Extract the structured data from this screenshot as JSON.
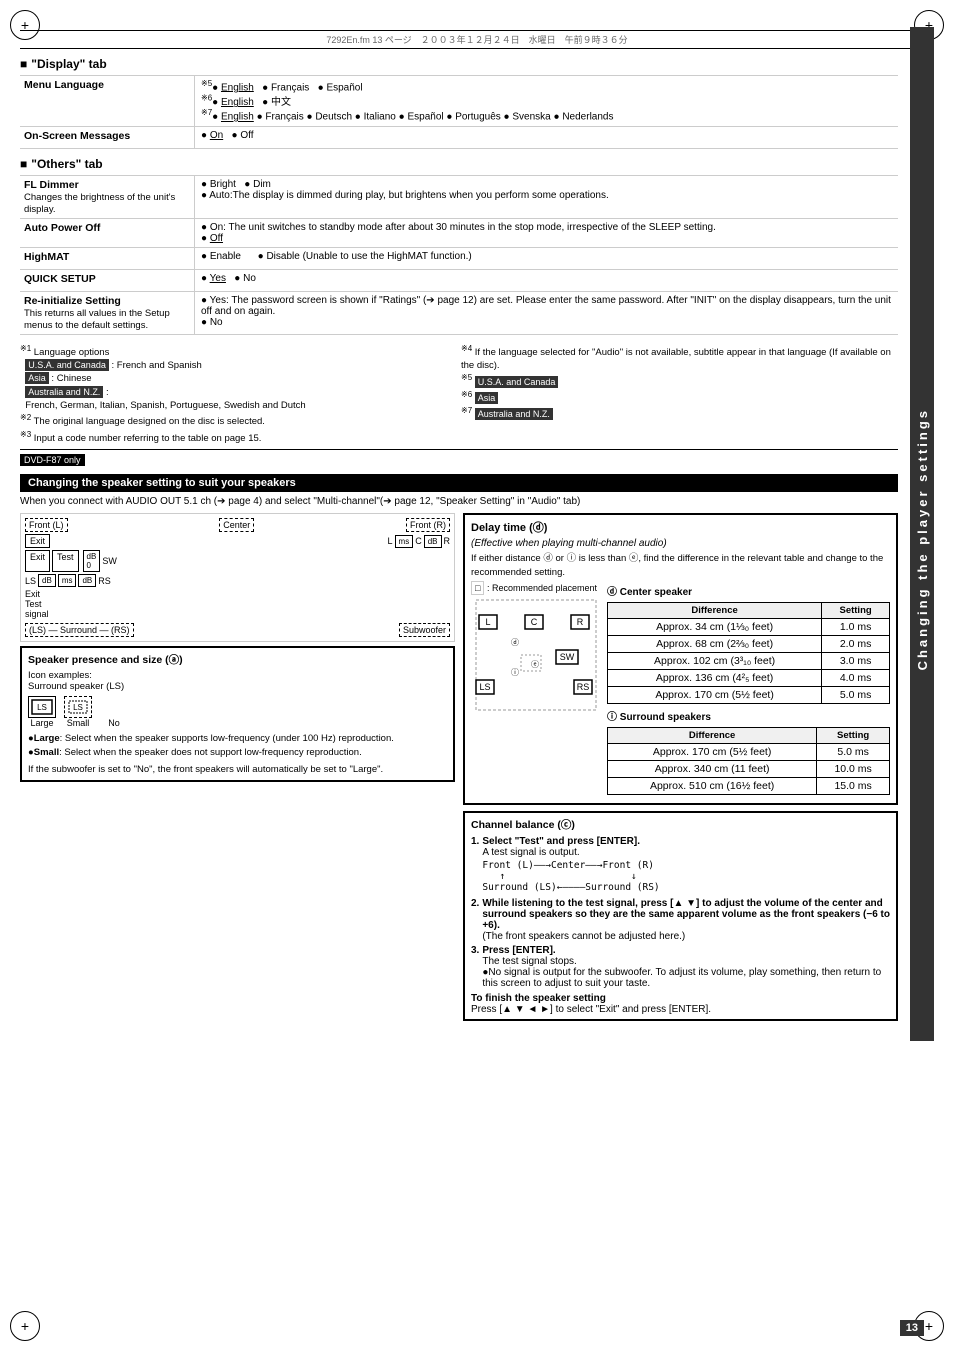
{
  "page": {
    "header_line": "7292En.fm  13 ページ　２００３年１２月２４日　水曜日　午前９時３６分",
    "page_number": "13",
    "sidebar_text": "Changing the player settings"
  },
  "display_tab": {
    "title": "\"Display\" tab",
    "rows": [
      {
        "label": "Menu Language",
        "value": "※5● English  ● Français  ● Español\n※6● English  ● 中文\n※7● English  ● Français  ● Deutsch  ● Italiano  ● Español  ● Português  ● Svenska  ● Nederlands"
      },
      {
        "label": "On-Screen Messages",
        "value": "● On  ● Off"
      }
    ]
  },
  "others_tab": {
    "title": "\"Others\" tab",
    "rows": [
      {
        "label": "FL Dimmer",
        "sublabel": "Changes the brightness of the unit's display.",
        "value": "● Bright  ● Dim\n● Auto:The display is dimmed during play, but brightens when you perform some operations."
      },
      {
        "label": "Auto Power Off",
        "value": "● On:  The unit switches to standby mode after about 30 minutes in the stop mode, irrespective of the SLEEP setting.\n● Off"
      },
      {
        "label": "HighMAT",
        "value": "● Enable        ● Disable (Unable to use the HighMAT function.)"
      },
      {
        "label": "QUICK SETUP",
        "value": "● Yes  ● No"
      },
      {
        "label": "Re-initialize Setting",
        "sublabel": "This returns all values in the Setup menus to the default settings.",
        "value": "● Yes: The password screen is shown if \"Ratings\" (➔ page 12) are set. Please enter the same password. After \"INIT\" on the display disappears, turn the unit off and on again.\n● No"
      }
    ]
  },
  "notes": {
    "left": [
      "※1  Language options",
      "U.S.A. and Canada : French and Spanish",
      "Asia : Chinese",
      "Australia and N.Z. :",
      "French, German, Italian, Spanish, Portuguese, Swedish and Dutch",
      "※2  The original language designed on the disc is selected.",
      "※3  Input a code number referring to the table on page 15."
    ],
    "right": [
      "※4  If the language selected for \"Audio\" is not available, subtitle appear in that language (If available on the disc).",
      "※5  U.S.A. and Canada",
      "※6  Asia",
      "※7  Australia and N.Z."
    ]
  },
  "dvd_only": "DVD-F87 only",
  "speaker_section": {
    "title": "Changing the speaker setting to suit your speakers",
    "subtitle": "When you connect with AUDIO OUT 5.1 ch (➔ page 4) and select \"Multi-channel\"(➔ page 12, \"Speaker Setting\" in \"Audio\" tab)",
    "diagram": {
      "front_l": "Front (L)",
      "center": "Center",
      "front_r": "Front (R)",
      "surround_l": "(LS)",
      "surround": "Surround",
      "surround_r": "(RS)",
      "subwoofer": "Subwoofer",
      "exit_label": "Exit",
      "test_label": "Test signal"
    }
  },
  "speaker_presence": {
    "title": "Speaker presence and size (ⓐ)",
    "icon_examples_label": "Icon examples:",
    "icon_surround_label": "Surround speaker (LS)",
    "large_label": "Large",
    "small_label": "Small",
    "no_label": "No",
    "large_desc": "Large: Select when the speaker supports low-frequency (under 100 Hz) reproduction.",
    "small_desc": "Small: Select when the speaker does not support low-frequency reproduction.",
    "note": "If the subwoofer is set to \"No\", the front speakers will automatically be set to \"Large\"."
  },
  "delay_time": {
    "title": "Delay time (ⓓ)",
    "subtitle": "(Effective when playing multi-channel audio)",
    "description": "If either distance ⓓ or ⓘ is less than ⓔ, find the difference in the relevant table and change to the recommended setting.",
    "recommended_label": ": Recommended placement",
    "center_speaker": {
      "title": "ⓓ Center speaker",
      "col1": "Difference",
      "col2": "Setting",
      "rows": [
        {
          "diff": "Approx. 34 cm (1⅓₀ feet)",
          "setting": "1.0 ms"
        },
        {
          "diff": "Approx. 68 cm (2⅔₀ feet)",
          "setting": "2.0 ms"
        },
        {
          "diff": "Approx. 102 cm (3³₁₀ feet)",
          "setting": "3.0 ms"
        },
        {
          "diff": "Approx. 136 cm (4²₅ feet)",
          "setting": "4.0 ms"
        },
        {
          "diff": "Approx. 170 cm (5½ feet)",
          "setting": "5.0 ms"
        }
      ]
    },
    "surround_speakers": {
      "title": "ⓘ Surround speakers",
      "col1": "Difference",
      "col2": "Setting",
      "rows": [
        {
          "diff": "Approx. 170 cm (5½ feet)",
          "setting": "5.0 ms"
        },
        {
          "diff": "Approx. 340 cm (11 feet)",
          "setting": "10.0 ms"
        },
        {
          "diff": "Approx. 510 cm (16½ feet)",
          "setting": "15.0 ms"
        }
      ]
    }
  },
  "channel_balance": {
    "title": "Channel balance (ⓒ)",
    "steps": [
      {
        "num": "1.",
        "bold_part": "Select \"Test\" and press [ENTER].",
        "text": "A test signal is output.",
        "diagram": "Front (L)——→Center——→Front (R)\n↑                                    ↓\nSurround (LS)←——————Surround (RS)"
      },
      {
        "num": "2.",
        "bold_part": "While listening to the test signal, press [▲ ▼] to adjust the volume of the center and surround speakers so they are the same apparent volume as the front speakers (−6 to +6).",
        "text": "(The front speakers cannot be adjusted here.)"
      },
      {
        "num": "3.",
        "bold_part": "Press [ENTER].",
        "text": "The test signal stops.\n●No signal is output for the subwoofer. To adjust its volume, play something, then return to this screen to adjust to suit your taste."
      }
    ],
    "finish_title": "To finish the speaker setting",
    "finish_text": "Press [▲ ▼ ◄ ►] to select \"Exit\" and press [ENTER]."
  }
}
